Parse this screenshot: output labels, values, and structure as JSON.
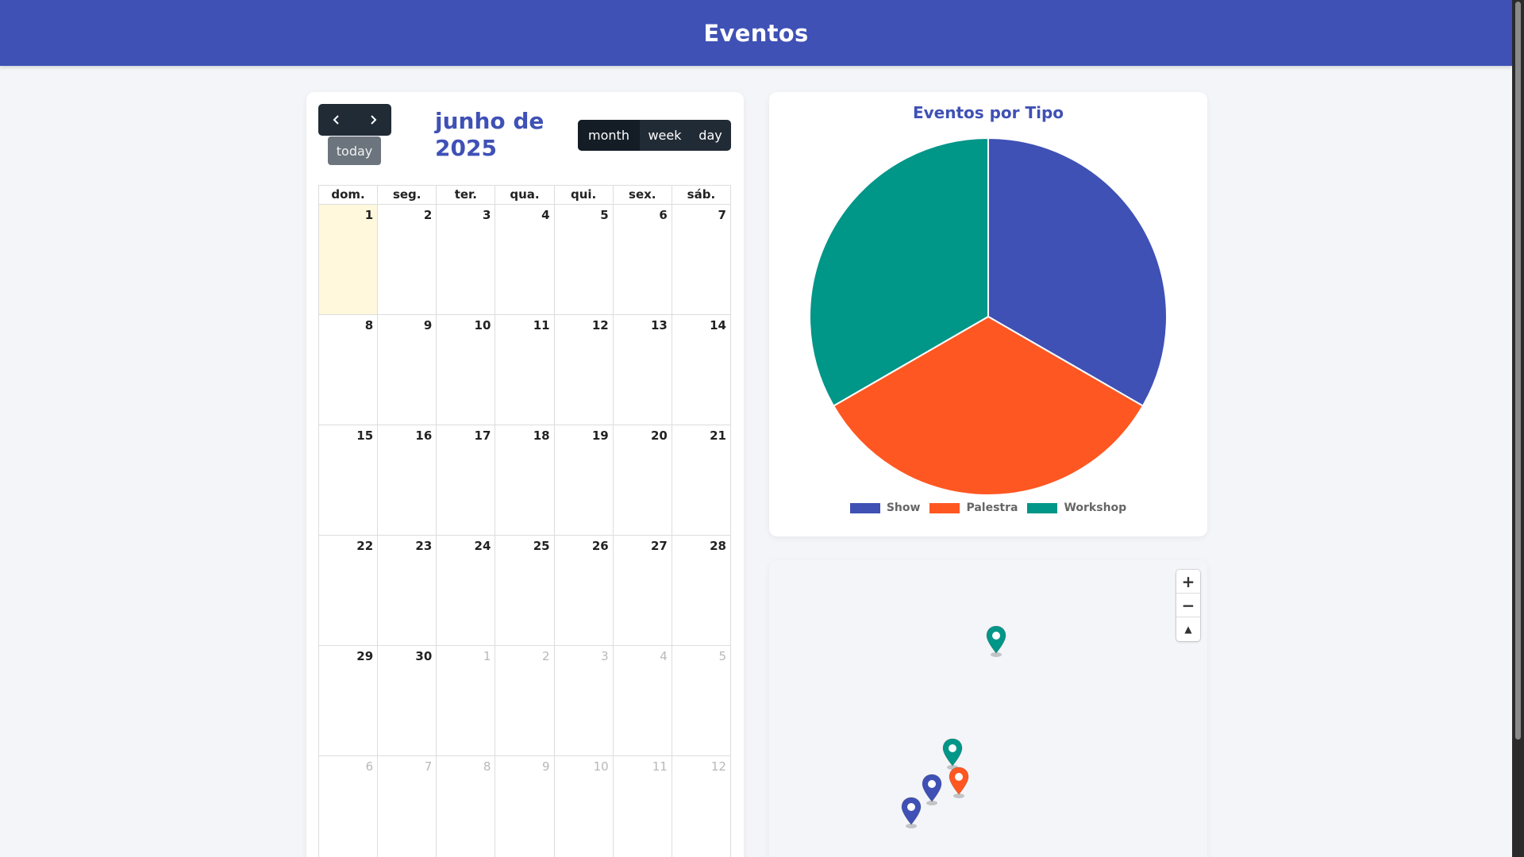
{
  "header": {
    "title": "Eventos"
  },
  "calendar": {
    "title": "junho de 2025",
    "today_label": "today",
    "views": [
      "month",
      "week",
      "day"
    ],
    "active_view": "month",
    "weekday_headers": [
      "dom.",
      "seg.",
      "ter.",
      "qua.",
      "qui.",
      "sex.",
      "sáb."
    ],
    "weeks": [
      [
        "1",
        "2",
        "3",
        "4",
        "5",
        "6",
        "7"
      ],
      [
        "8",
        "9",
        "10",
        "11",
        "12",
        "13",
        "14"
      ],
      [
        "15",
        "16",
        "17",
        "18",
        "19",
        "20",
        "21"
      ],
      [
        "22",
        "23",
        "24",
        "25",
        "26",
        "27",
        "28"
      ],
      [
        "29",
        "30",
        "1",
        "2",
        "3",
        "4",
        "5"
      ],
      [
        "6",
        "7",
        "8",
        "9",
        "10",
        "11",
        "12"
      ]
    ]
  },
  "chart_data": {
    "type": "pie",
    "title": "Eventos por Tipo",
    "categories": [
      "Show",
      "Palestra",
      "Workshop"
    ],
    "values": [
      1,
      1,
      1
    ],
    "colors": [
      "#3f51b5",
      "#ff5722",
      "#009688"
    ],
    "legend": "bottom"
  },
  "map": {
    "zoom_in": "+",
    "zoom_out": "−",
    "reset_north": "▲",
    "markers": [
      {
        "type": "Workshop",
        "color": "#009688"
      },
      {
        "type": "Workshop",
        "color": "#009688"
      },
      {
        "type": "Show",
        "color": "#3f51b5"
      },
      {
        "type": "Palestra",
        "color": "#ff5722"
      },
      {
        "type": "Show",
        "color": "#3f51b5"
      }
    ]
  }
}
